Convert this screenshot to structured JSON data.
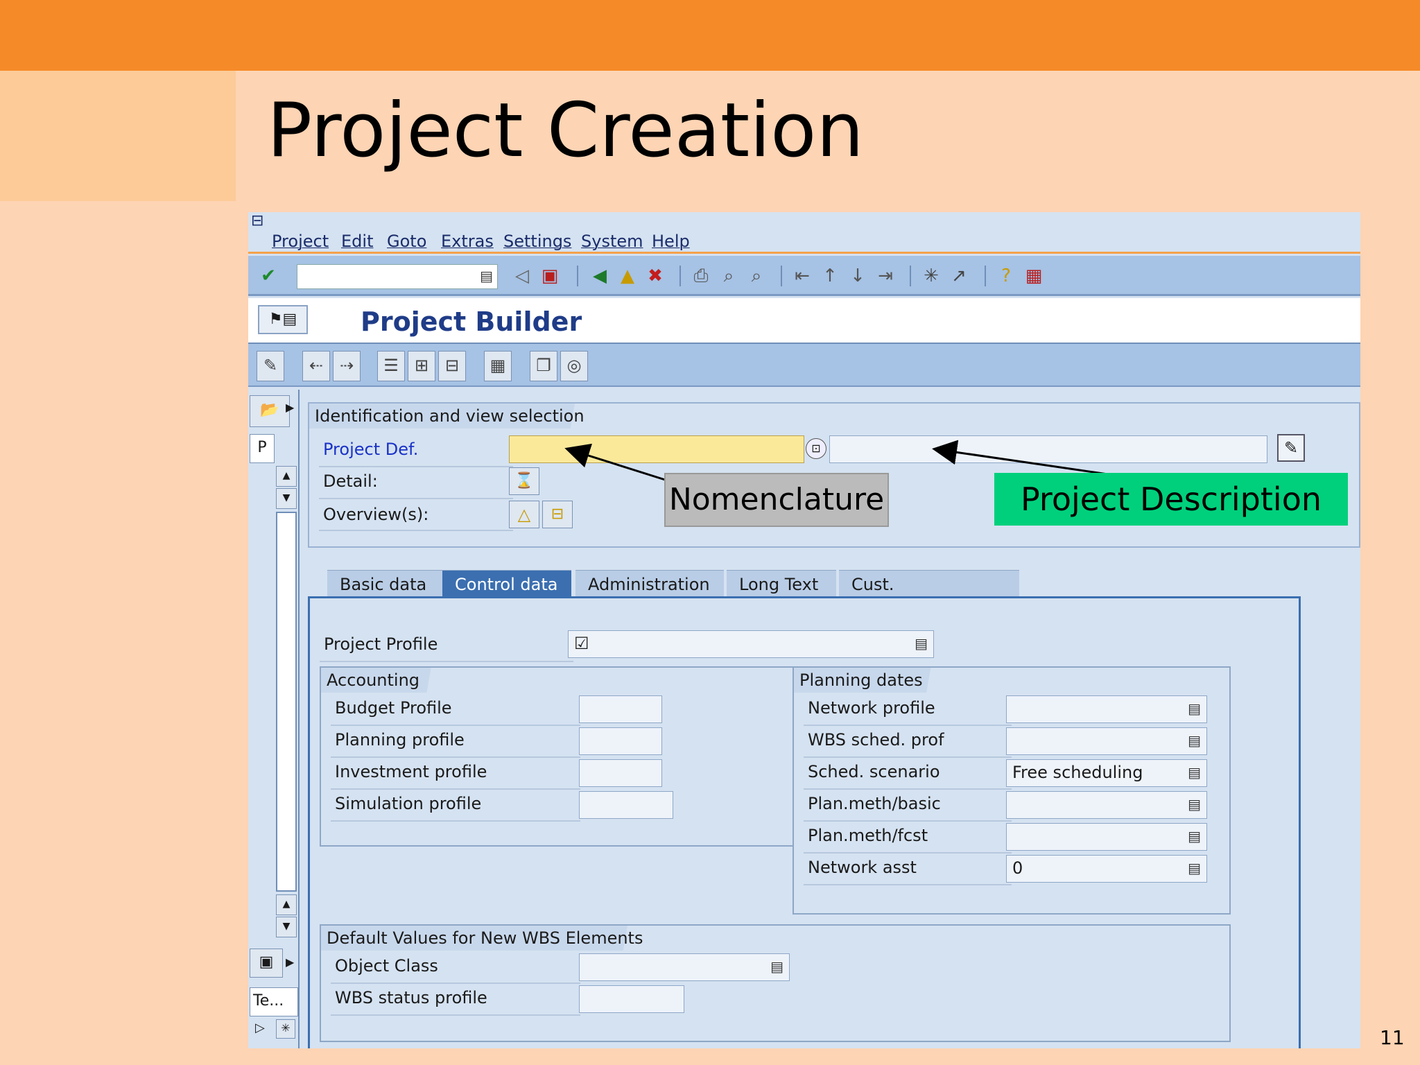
{
  "slide": {
    "title": "Project Creation",
    "page_number": "11"
  },
  "colors": {
    "header_band": "#f58a28",
    "slide_bg": "#fdd4b4",
    "sap_bg": "#d5e2f1",
    "sap_toolbar": "#a6c2e4",
    "active_tab": "#3b6fb0",
    "callout_green": "#00d07c",
    "callout_gray": "#bbbbbb"
  },
  "menubar": {
    "items": [
      "Project",
      "Edit",
      "Goto",
      "Extras",
      "Settings",
      "System",
      "Help"
    ]
  },
  "toolbar": {
    "command_field_value": "",
    "icons": [
      "enter-icon",
      "back-icon",
      "save-icon",
      "back-green-icon",
      "exit-icon",
      "cancel-icon",
      "print-icon",
      "find-icon",
      "find-next-icon",
      "first-page-icon",
      "prev-page-icon",
      "next-page-icon",
      "last-page-icon",
      "new-session-icon",
      "shortcut-icon",
      "help-icon",
      "layout-icon"
    ]
  },
  "app": {
    "title": "Project Builder"
  },
  "ident": {
    "header": "Identification and view selection",
    "project_def_label": "Project Def.",
    "project_def_value": "",
    "project_desc_value": "",
    "detail_label": "Detail:",
    "overview_label": "Overview(s):"
  },
  "callouts": {
    "nomenclature": "Nomenclature",
    "project_description": "Project  Description"
  },
  "nav": {
    "p_label": "P",
    "te_label": "Te..."
  },
  "tabs": [
    {
      "label": "Basic data",
      "active": false
    },
    {
      "label": "Control data",
      "active": true
    },
    {
      "label": "Administration",
      "active": false
    },
    {
      "label": "Long Text",
      "active": false
    },
    {
      "label": "Cust. enhancement",
      "active": false
    }
  ],
  "control": {
    "project_profile_label": "Project Profile",
    "project_profile_value": "☑",
    "accounting": {
      "header": "Accounting",
      "rows": [
        {
          "label": "Budget Profile",
          "value": ""
        },
        {
          "label": "Planning profile",
          "value": ""
        },
        {
          "label": "Investment profile",
          "value": ""
        },
        {
          "label": "Simulation profile",
          "value": ""
        }
      ]
    },
    "planning": {
      "header": "Planning dates",
      "rows": [
        {
          "label": "Network profile",
          "value": ""
        },
        {
          "label": "WBS sched. prof",
          "value": ""
        },
        {
          "label": "Sched. scenario",
          "value": "Free scheduling"
        },
        {
          "label": "Plan.meth/basic",
          "value": ""
        },
        {
          "label": "Plan.meth/fcst",
          "value": ""
        },
        {
          "label": "Network asst",
          "value": "0"
        }
      ]
    },
    "defaults": {
      "header": "Default Values for New WBS Elements",
      "rows": [
        {
          "label": "Object Class",
          "value": ""
        },
        {
          "label": "WBS status profile",
          "value": ""
        }
      ]
    }
  }
}
